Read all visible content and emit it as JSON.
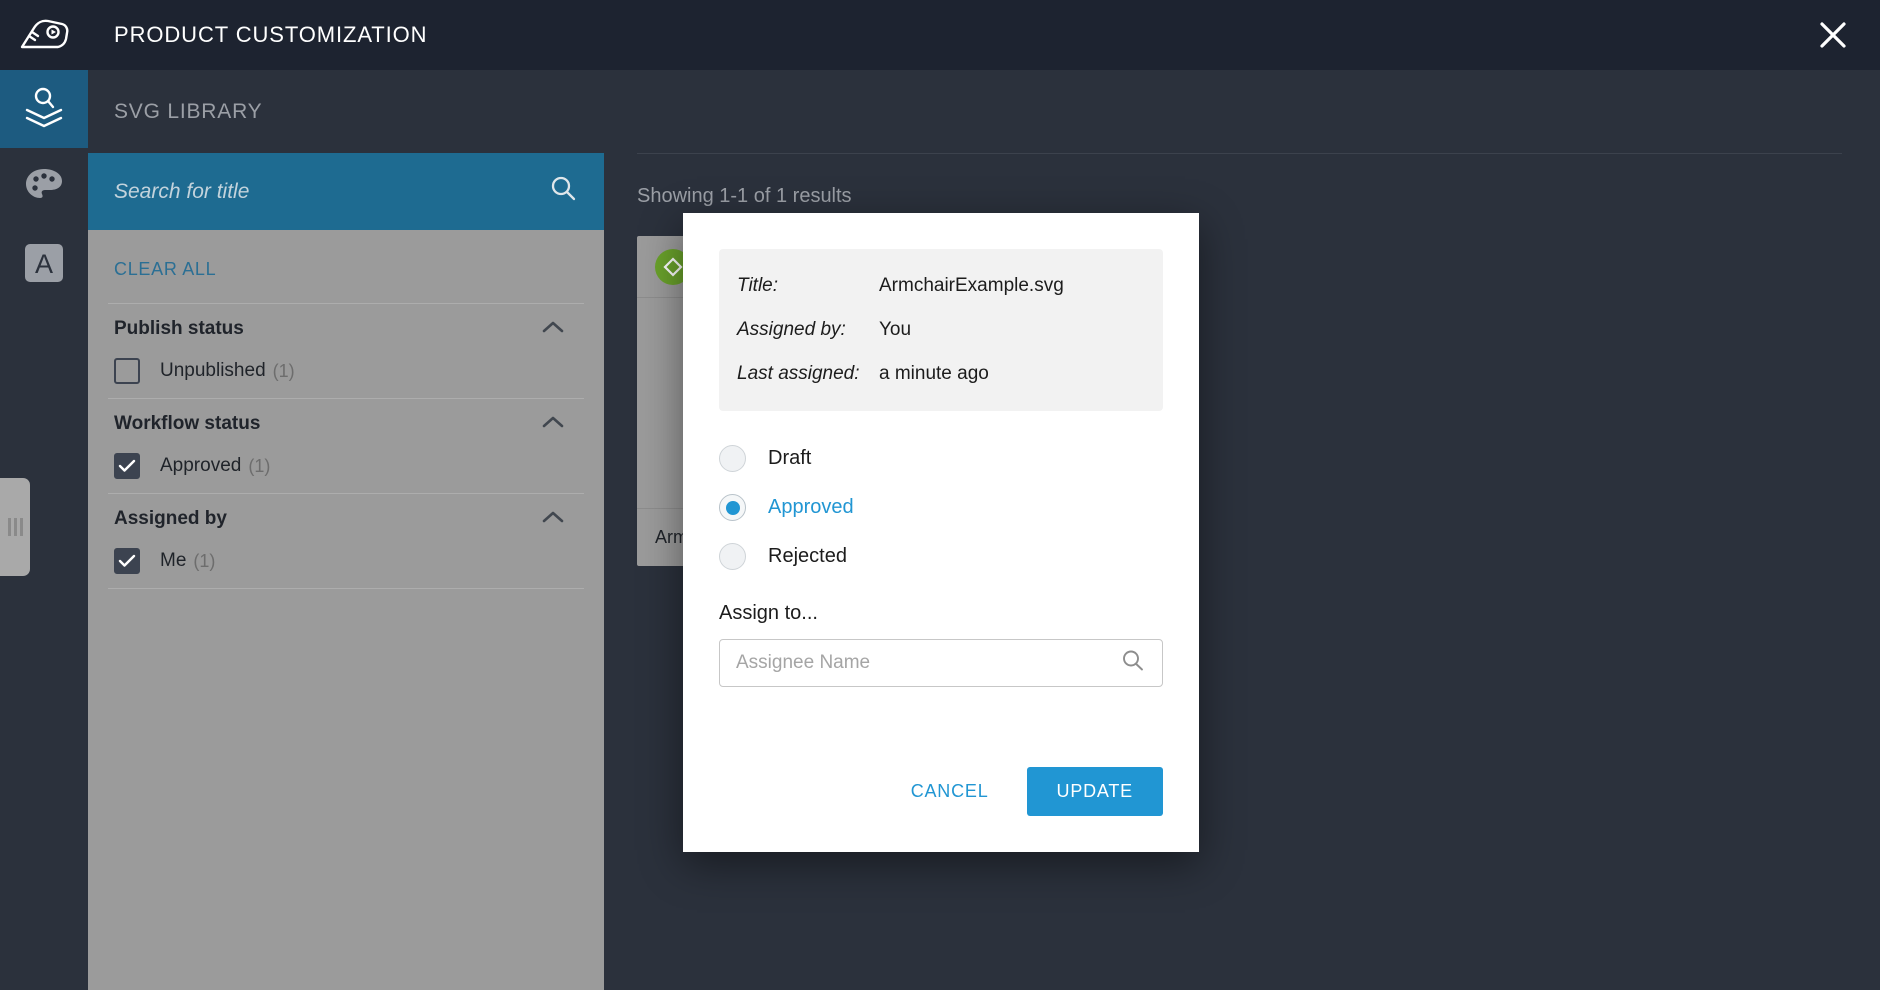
{
  "header": {
    "app_title": "PRODUCT CUSTOMIZATION",
    "logo_icon": "sneaker-icon",
    "close_icon": "close-icon"
  },
  "rail": {
    "items": [
      {
        "icon": "svg-library-icon",
        "name": "svg-library",
        "active": true
      },
      {
        "icon": "palette-icon",
        "name": "color-palette",
        "active": false
      },
      {
        "icon": "letter-a-icon",
        "name": "typography",
        "active": false
      }
    ],
    "drag_handle_icon": "drag-handle-icon"
  },
  "library": {
    "title": "SVG LIBRARY"
  },
  "search": {
    "value": "",
    "placeholder": "Search for title",
    "icon": "search-icon"
  },
  "filters": {
    "clear_all_label": "CLEAR ALL",
    "collapse_icon": "chevron-up-icon",
    "groups": [
      {
        "title": "Publish status",
        "options": [
          {
            "label": "Unpublished",
            "count": "(1)",
            "checked": false
          }
        ]
      },
      {
        "title": "Workflow status",
        "options": [
          {
            "label": "Approved",
            "count": "(1)",
            "checked": true
          }
        ]
      },
      {
        "title": "Assigned by",
        "options": [
          {
            "label": "Me",
            "count": "(1)",
            "checked": true
          }
        ]
      }
    ]
  },
  "results": {
    "count_text": "Showing 1-1 of 1 results",
    "card": {
      "status_icon": "approved-diamond-icon",
      "status_color": "#6aa22b",
      "title": "ArmchairExample.svg"
    }
  },
  "modal": {
    "info": {
      "title_label": "Title:",
      "title_value": "ArmchairExample.svg",
      "assigned_by_label": "Assigned by:",
      "assigned_by_value": "You",
      "last_assigned_label": "Last assigned:",
      "last_assigned_value": "a minute ago"
    },
    "status_options": [
      {
        "label": "Draft",
        "selected": false
      },
      {
        "label": "Approved",
        "selected": true
      },
      {
        "label": "Rejected",
        "selected": false
      }
    ],
    "assign": {
      "label": "Assign to...",
      "value": "",
      "placeholder": "Assignee Name",
      "icon": "search-icon"
    },
    "cancel_label": "CANCEL",
    "update_label": "UPDATE"
  },
  "colors": {
    "topbar": "#1d2330",
    "app_bg": "#2b313c",
    "rail_active": "#1d5b80",
    "search_bar": "#1e6b91",
    "panel": "#9b9b9b",
    "accent": "#2196d3",
    "link": "#2b6f94",
    "approved_green": "#6aa22b"
  }
}
